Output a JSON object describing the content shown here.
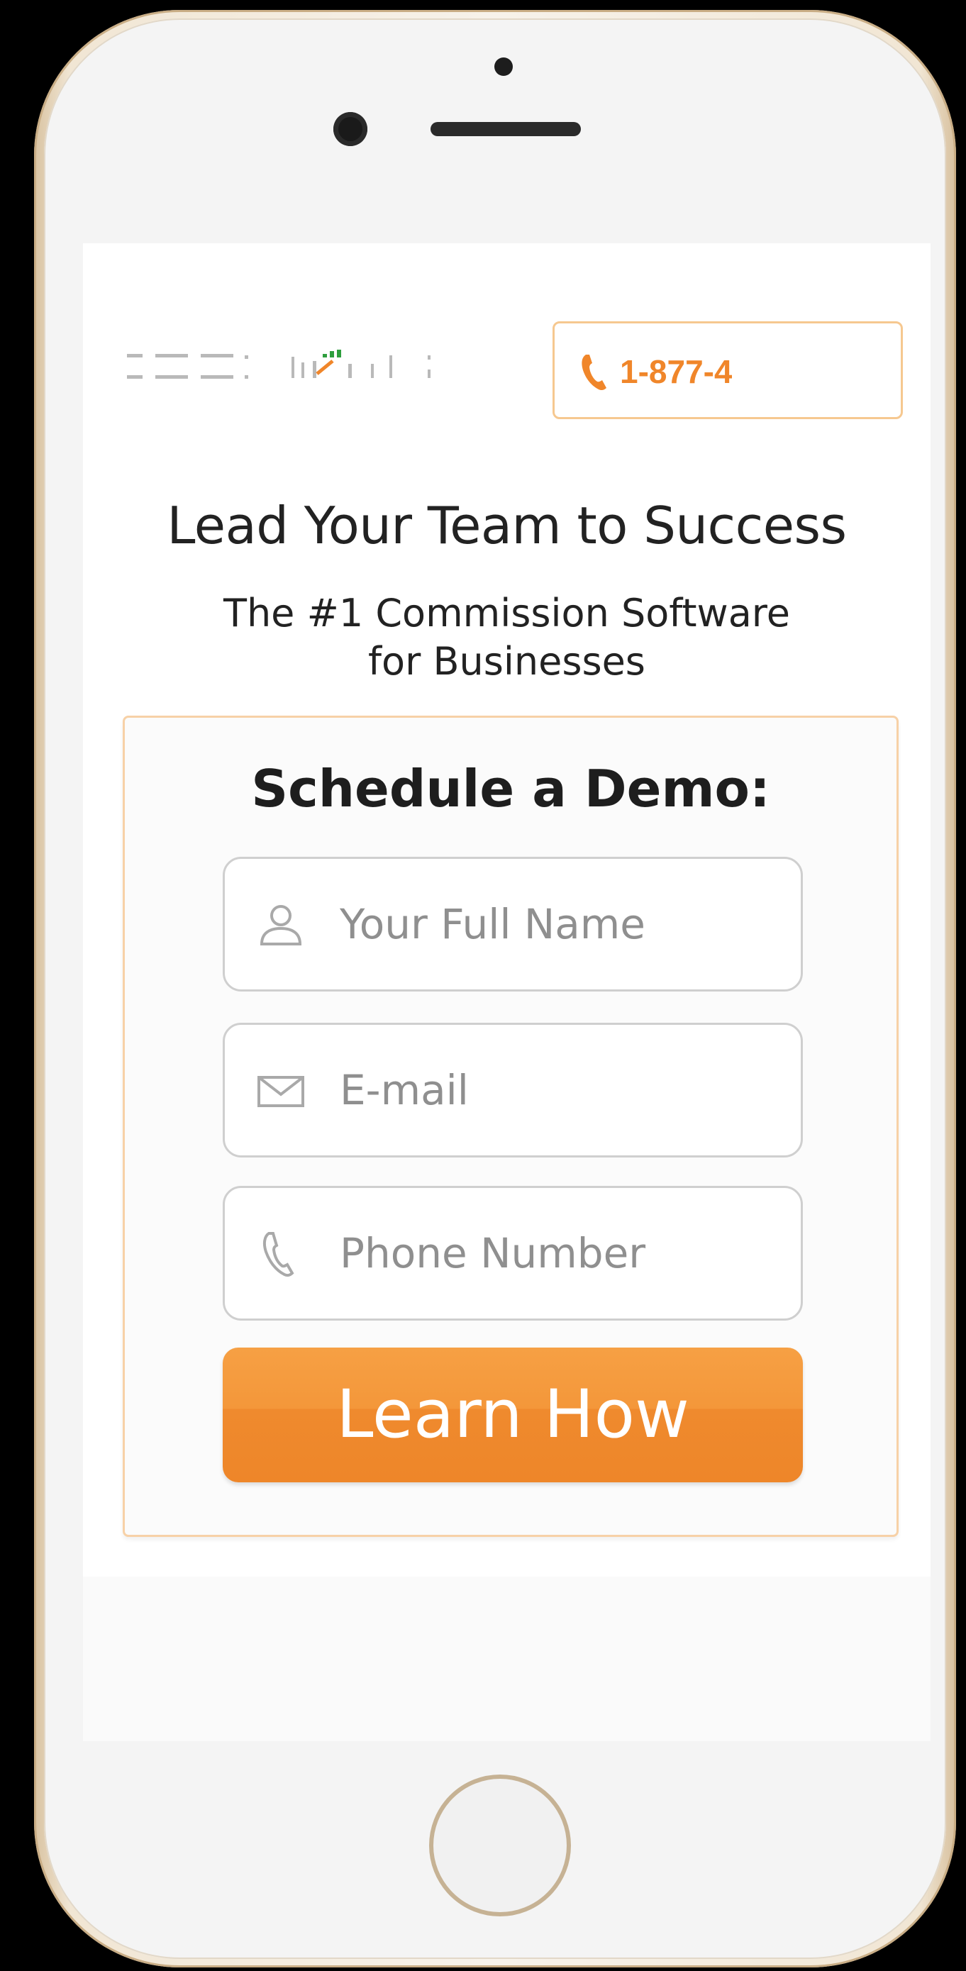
{
  "header": {
    "phone_number": "1-877-4"
  },
  "hero": {
    "headline": "Lead Your Team to Success",
    "subheadline_line1": "The #1 Commission Software",
    "subheadline_line2": "for Businesses"
  },
  "demo_form": {
    "title": "Schedule a Demo:",
    "fields": [
      {
        "icon": "user-icon",
        "placeholder": "Your Full Name"
      },
      {
        "icon": "envelope-icon",
        "placeholder": "E-mail"
      },
      {
        "icon": "phone-icon",
        "placeholder": "Phone Number"
      }
    ],
    "submit_label": "Learn How"
  },
  "colors": {
    "accent": "#f0862a",
    "button": "#ee8629",
    "card_border": "#f7d1a7",
    "logo_green": "#2e9e3e"
  }
}
